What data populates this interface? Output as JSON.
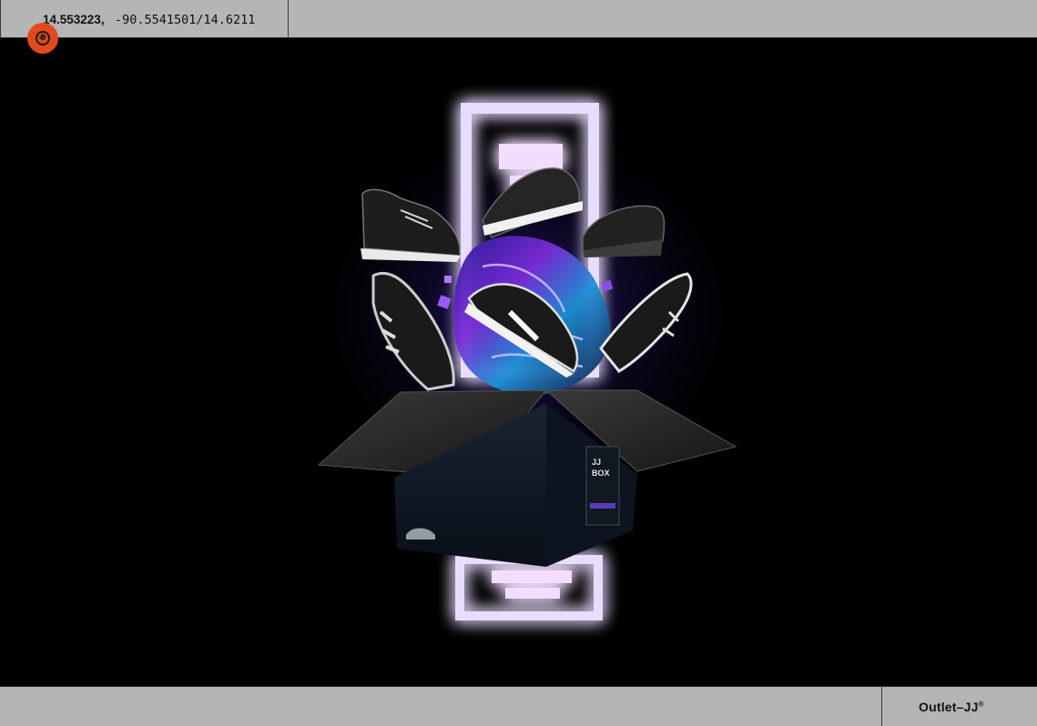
{
  "header": {
    "coord_main": "14.553223,",
    "coord_rest": "-90.5541501/14.6211"
  },
  "badge": {
    "glyph": "₴",
    "icon": "currency-icon",
    "color": "#e14a1e"
  },
  "hero": {
    "description_icon": "sneaker-box-artwork",
    "box_label": "JJ\nBOX",
    "neon_color": "#c9b8ff"
  },
  "footer": {
    "brand": "Outlet–JJ",
    "brand_mark": "®"
  },
  "colors": {
    "bar": "#b5b5b5",
    "background": "#000000",
    "accent": "#e14a1e"
  }
}
